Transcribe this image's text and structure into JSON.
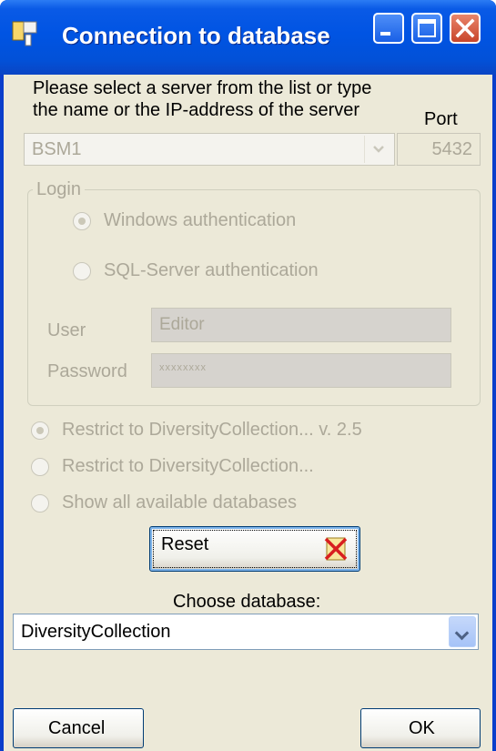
{
  "window": {
    "title": "Connection to database"
  },
  "server": {
    "instruction_line1": "Please select a server from the list or type",
    "instruction_line2": "the name or the IP-address of the server",
    "port_label": "Port",
    "server_value": "BSM1",
    "port_value": "5432"
  },
  "login": {
    "group_title": "Login",
    "windows_auth_label": "Windows authentication",
    "sql_auth_label": "SQL-Server authentication",
    "user_label": "User",
    "user_value": "Editor",
    "password_label": "Password",
    "password_value": "xxxxxxxx"
  },
  "filters": {
    "restrict_version_label": "Restrict to DiversityCollection... v. 2.5",
    "restrict_label": "Restrict to DiversityCollection...",
    "show_all_label": "Show all available databases"
  },
  "reset_label": "Reset",
  "database": {
    "choose_label": "Choose database:",
    "selected": "DiversityCollection"
  },
  "cancel_label": "Cancel",
  "ok_label": "OK",
  "colors": {
    "titlebar": "#0054e3",
    "client": "#ece9d8",
    "disabled_text": "#aca899",
    "close_button": "#c8452a"
  }
}
